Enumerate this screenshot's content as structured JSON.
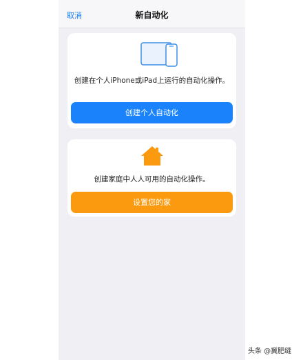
{
  "nav": {
    "cancel": "取消",
    "title": "新自动化"
  },
  "personal": {
    "icon": "iphone-ipad-icon",
    "description": "创建在个人iPhone或iPad上运行的自动化操作。",
    "button_label": "创建个人自动化",
    "button_color": "#1a82fa"
  },
  "home": {
    "icon": "home-icon",
    "description": "创建家庭中人人可用的自动化操作。",
    "button_label": "设置您的家",
    "button_color": "#fb9a0e"
  },
  "watermark": "头条 @冀肥缝",
  "colors": {
    "accent_blue": "#1d7cf2",
    "home_orange": "#fb9a0e",
    "background": "#efeff4"
  }
}
